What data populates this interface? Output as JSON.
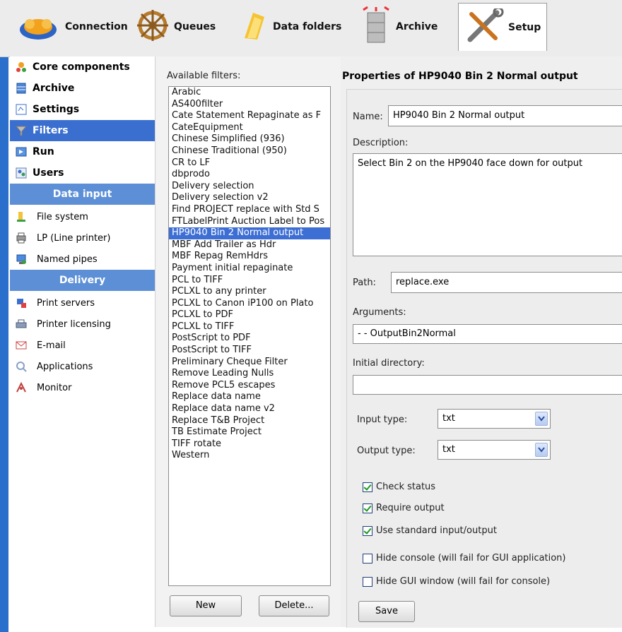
{
  "toolbar": {
    "items": [
      {
        "label": "Connection",
        "icon": "connection-icon"
      },
      {
        "label": "Queues",
        "icon": "queues-icon"
      },
      {
        "label": "Data folders",
        "icon": "data-folders-icon"
      },
      {
        "label": "Archive",
        "icon": "archive-icon"
      },
      {
        "label": "Setup",
        "icon": "setup-icon",
        "active": true
      }
    ]
  },
  "sidebar": {
    "main_items": [
      {
        "label": "Core components",
        "icon": "core-components-icon"
      },
      {
        "label": "Archive",
        "icon": "archive-icon"
      },
      {
        "label": "Settings",
        "icon": "settings-icon"
      },
      {
        "label": "Filters",
        "icon": "filters-icon",
        "selected": true
      },
      {
        "label": "Run",
        "icon": "run-icon"
      },
      {
        "label": "Users",
        "icon": "users-icon"
      }
    ],
    "data_input_header": "Data input",
    "data_input_items": [
      {
        "label": "File system",
        "icon": "file-system-icon"
      },
      {
        "label": "LP (Line printer)",
        "icon": "line-printer-icon"
      },
      {
        "label": "Named pipes",
        "icon": "named-pipes-icon"
      }
    ],
    "delivery_header": "Delivery",
    "delivery_items": [
      {
        "label": "Print servers",
        "icon": "print-servers-icon"
      },
      {
        "label": "Printer licensing",
        "icon": "printer-licensing-icon"
      },
      {
        "label": "E-mail",
        "icon": "email-icon"
      },
      {
        "label": "Applications",
        "icon": "applications-icon"
      },
      {
        "label": "Monitor",
        "icon": "monitor-icon"
      }
    ]
  },
  "filters_panel": {
    "label": "Available filters:",
    "items": [
      "Arabic",
      "AS400filter",
      "Cate Statement Repaginate as F",
      "CateEquipment",
      "Chinese Simplified (936)",
      "Chinese Traditional (950)",
      "CR to LF",
      "dbprodo",
      "Delivery selection",
      "Delivery selection v2",
      "Find PROJECT replace with Std S",
      "FTLabelPrint Auction Label to Pos",
      "HP9040 Bin 2 Normal output",
      "MBF Add Trailer as Hdr",
      "MBF Repag RemHdrs",
      "Payment initial repaginate",
      "PCL to TIFF",
      "PCLXL to any printer",
      "PCLXL to Canon iP100 on Plato",
      "PCLXL to PDF",
      "PCLXL to TIFF",
      "PostScript to PDF",
      "PostScript to TIFF",
      "Preliminary Cheque Filter",
      "Remove Leading Nulls",
      "Remove PCL5 escapes",
      "Replace data name",
      "Replace data name v2",
      "Replace T&B Project",
      "TB Estimate Project",
      "TIFF rotate",
      "Western"
    ],
    "selected_index": 12,
    "new_button": "New",
    "delete_button": "Delete..."
  },
  "properties": {
    "title": "Properties of HP9040 Bin 2 Normal output",
    "name_label": "Name:",
    "name_value": "HP9040 Bin 2 Normal output",
    "description_label": "Description:",
    "description_value": "Select Bin 2 on the HP9040 face down for output",
    "path_label": "Path:",
    "path_value": "replace.exe",
    "arguments_label": "Arguments:",
    "arguments_value": "- - OutputBin2Normal",
    "initial_dir_label": "Initial directory:",
    "initial_dir_value": "",
    "input_type_label": "Input type:",
    "input_type_value": "txt",
    "output_type_label": "Output type:",
    "output_type_value": "txt",
    "checkboxes": [
      {
        "label": "Check status",
        "checked": true
      },
      {
        "label": "Require output",
        "checked": true
      },
      {
        "label": "Use standard input/output",
        "checked": true
      },
      {
        "label": "Hide console (will fail for GUI application)",
        "checked": false
      },
      {
        "label": "Hide GUI window (will fail for console)",
        "checked": false
      }
    ],
    "save_button": "Save"
  },
  "colors": {
    "accent": "#3a6fd0",
    "header_bar": "#5d8fd6",
    "left_strip": "#2b6fcd"
  }
}
